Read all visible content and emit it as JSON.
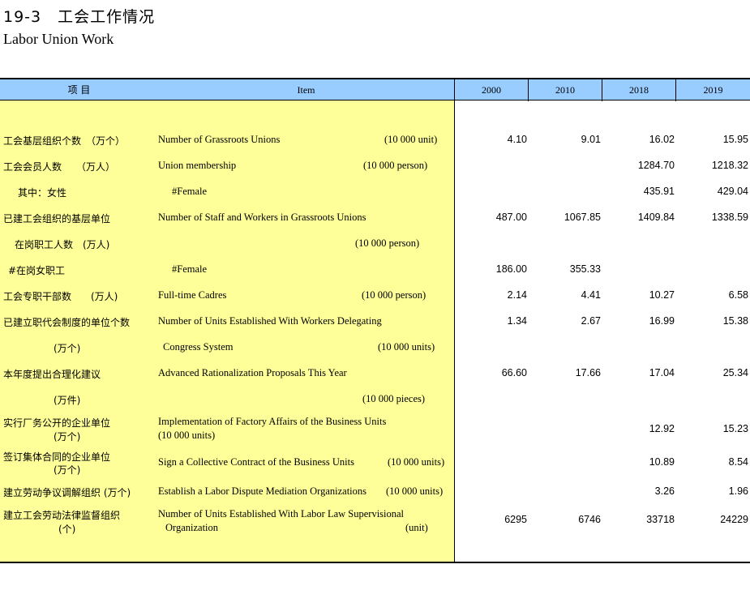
{
  "title": {
    "cn": "19-3　工会工作情况",
    "en": "Labor Union Work"
  },
  "header": {
    "item_cn": "项 目",
    "item_en": "Item",
    "years": [
      "2000",
      "2010",
      "2018",
      "2019"
    ]
  },
  "rows": [
    {
      "cn": "工会基层组织个数　（万个）",
      "en": "Number of Grassroots Unions",
      "unit": "(10 000 unit)",
      "v": [
        "4.10",
        "9.01",
        "16.02",
        "15.95"
      ]
    },
    {
      "cn": "工会会员人数　　（万人）",
      "en": "Union membership",
      "unit": "(10 000 person)",
      "v": [
        "",
        "",
        "1284.70",
        "1218.32"
      ]
    },
    {
      "cn": "其中：女性",
      "en": "#Female",
      "unit": "",
      "v": [
        "",
        "",
        "435.91",
        "429.04"
      ]
    },
    {
      "cn": "已建工会组织的基层单位",
      "en": "Number of Staff and Workers in Grassroots Unions",
      "unit": "",
      "v": [
        "487.00",
        "1067.85",
        "1409.84",
        "1338.59"
      ]
    },
    {
      "cn": "在岗职工人数　(万人)",
      "en": "",
      "unit": "(10 000 person)",
      "v": [
        "",
        "",
        "",
        ""
      ]
    },
    {
      "cn": "#在岗女职工",
      "en": "#Female",
      "unit": "",
      "v": [
        "186.00",
        "355.33",
        "",
        ""
      ]
    },
    {
      "cn": "工会专职干部数　　(万人)",
      "en": "Full-time Cadres",
      "unit": "(10 000 person)",
      "v": [
        "2.14",
        "4.41",
        "10.27",
        "6.58"
      ]
    },
    {
      "cn": "已建立职代会制度的单位个数",
      "en": "Number of Units Established With Workers Delegating",
      "unit": "",
      "v": [
        "1.34",
        "2.67",
        "16.99",
        "15.38"
      ]
    },
    {
      "cn": "(万个)",
      "en": "Congress System",
      "unit": "(10 000 units)",
      "v": [
        "",
        "",
        "",
        ""
      ]
    },
    {
      "cn": "本年度提出合理化建议",
      "en": "Advanced Rationalization Proposals This Year",
      "unit": "",
      "v": [
        "66.60",
        "17.66",
        "17.04",
        "25.34"
      ]
    },
    {
      "cn": "(万件)",
      "en": "",
      "unit": "(10 000 pieces)",
      "v": [
        "",
        "",
        "",
        ""
      ]
    },
    {
      "cn": "实行厂务公开的企业单位",
      "cn2": "(万个)",
      "en": "Implementation of Factory Affairs of the Business Units",
      "en2": "(10 000 units)",
      "unit": "",
      "v": [
        "",
        "",
        "12.92",
        "15.23"
      ]
    },
    {
      "cn": "签订集体合同的企业单位",
      "cn2": "(万个)",
      "en": "Sign a Collective Contract of the Business Units",
      "unit": "(10 000 units)",
      "v": [
        "",
        "",
        "10.89",
        "8.54"
      ]
    },
    {
      "cn": "建立劳动争议调解组织 (万个)",
      "en": "Establish a Labor Dispute Mediation Organizations",
      "unit": "(10 000 units)",
      "v": [
        "",
        "",
        "3.26",
        "1.96"
      ]
    },
    {
      "cn": "建立工会劳动法律监督组织",
      "cn2": "(个)",
      "en": "Number of Units Established With Labor Law Supervisional",
      "en2": "Organization",
      "unit": "(unit)",
      "v": [
        "6295",
        "6746",
        "33718",
        "24229"
      ]
    }
  ]
}
